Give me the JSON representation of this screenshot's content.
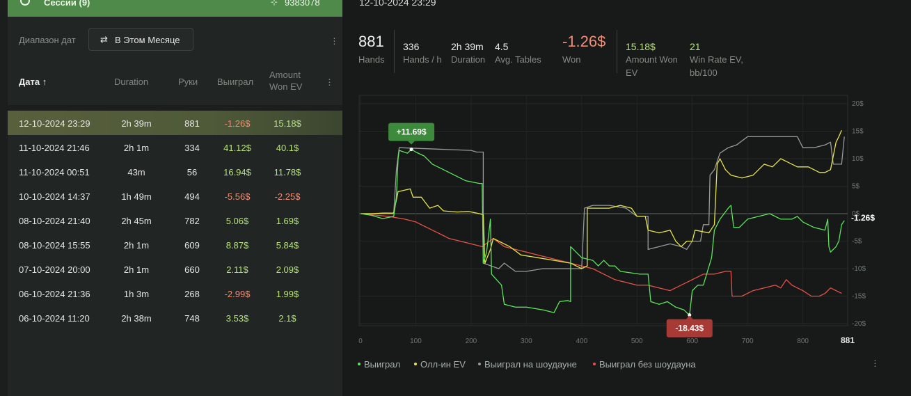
{
  "sessions_bar": {
    "title": "Сессии (9)",
    "total_hands": "9383078"
  },
  "filter": {
    "label": "Диапазон дат",
    "value": "В Этом Месяце"
  },
  "table": {
    "headers": {
      "date": "Дата ↑",
      "duration": "Duration",
      "hands": "Руки",
      "won": "Выиграл",
      "ev_line1": "Amount",
      "ev_line2": "Won EV"
    },
    "rows": [
      {
        "date": "12-10-2024 23:29",
        "duration": "2h 39m",
        "hands": "881",
        "won": "-1.26$",
        "ev": "15.18$"
      },
      {
        "date": "11-10-2024 21:46",
        "duration": "2h 1m",
        "hands": "334",
        "won": "41.12$",
        "ev": "40.1$"
      },
      {
        "date": "11-10-2024 00:51",
        "duration": "43m",
        "hands": "56",
        "won": "16.94$",
        "ev": "11.78$"
      },
      {
        "date": "10-10-2024 14:37",
        "duration": "1h 49m",
        "hands": "494",
        "won": "-5.56$",
        "ev": "-2.25$"
      },
      {
        "date": "08-10-2024 21:40",
        "duration": "2h 45m",
        "hands": "782",
        "won": "5.06$",
        "ev": "1.69$"
      },
      {
        "date": "08-10-2024 15:55",
        "duration": "2h 1m",
        "hands": "609",
        "won": "8.87$",
        "ev": "5.84$"
      },
      {
        "date": "07-10-2024 20:00",
        "duration": "2h 1m",
        "hands": "660",
        "won": "2.11$",
        "ev": "2.09$"
      },
      {
        "date": "06-10-2024 21:36",
        "duration": "1h 3m",
        "hands": "268",
        "won": "-2.99$",
        "ev": "1.99$"
      },
      {
        "date": "06-10-2024 11:20",
        "duration": "2h 38m",
        "hands": "748",
        "won": "3.53$",
        "ev": "2.1$"
      }
    ]
  },
  "session": {
    "date": "12-10-2024 23:29",
    "hands": {
      "value": "881",
      "label": "Hands"
    },
    "hands_per_hour": {
      "value": "336",
      "label": "Hands / h"
    },
    "duration": {
      "value": "2h 39m",
      "label": "Duration"
    },
    "avg_tables": {
      "value": "4.5",
      "label": "Avg. Tables"
    },
    "won": {
      "value": "-1.26$",
      "label": "Won"
    },
    "amount_won_ev": {
      "value": "15.18$",
      "label_line1": "Amount Won",
      "label_line2": "EV"
    },
    "win_rate_ev": {
      "value": "21",
      "label_line1": "Win Rate EV,",
      "label_line2": "bb/100"
    }
  },
  "colors": {
    "won": "#5ce65c",
    "allin_ev": "#e8e44a",
    "showdown": "#9a9a9a",
    "nonshowdown": "#e8524a",
    "accent": "#4f8a4a"
  },
  "chart_data": {
    "type": "line",
    "xlim": [
      0,
      881
    ],
    "ylim": [
      -20,
      20
    ],
    "x_ticks": [
      "0",
      "100",
      "200",
      "300",
      "400",
      "500",
      "600",
      "700",
      "800"
    ],
    "x_end_label": "881",
    "y_ticks": [
      "20$",
      "15$",
      "10$",
      "5$",
      "0$",
      "-5$",
      "-10$",
      "-15$",
      "-20$"
    ],
    "max_annotation": {
      "x": 92,
      "y": 11.69,
      "label": "+11.69$"
    },
    "min_annotation": {
      "x": 595,
      "y": -18.43,
      "label": "-18.43$"
    },
    "final_label": "-1.26$",
    "grid": true,
    "legend_position": "bottom-left",
    "series": [
      {
        "name": "Выиграл",
        "color": "#5ce65c",
        "points": [
          [
            0,
            0
          ],
          [
            20,
            -0.3
          ],
          [
            40,
            -0.9
          ],
          [
            60,
            -0.5
          ],
          [
            65,
            3
          ],
          [
            68,
            10
          ],
          [
            70,
            11.5
          ],
          [
            85,
            11
          ],
          [
            92,
            11.69
          ],
          [
            100,
            11.2
          ],
          [
            115,
            10.5
          ],
          [
            130,
            9
          ],
          [
            150,
            8
          ],
          [
            170,
            7
          ],
          [
            190,
            6
          ],
          [
            215,
            5.5
          ],
          [
            220,
            5.5
          ],
          [
            222,
            -9
          ],
          [
            228,
            -7
          ],
          [
            235,
            -1
          ],
          [
            237,
            -11
          ],
          [
            255,
            -13
          ],
          [
            260,
            -16.5
          ],
          [
            280,
            -17
          ],
          [
            300,
            -17
          ],
          [
            330,
            -17.5
          ],
          [
            350,
            -18
          ],
          [
            360,
            -16
          ],
          [
            375,
            -15.8
          ],
          [
            380,
            -16
          ],
          [
            380,
            -6
          ],
          [
            400,
            -8
          ],
          [
            420,
            -8.5
          ],
          [
            430,
            -9.5
          ],
          [
            440,
            -8.5
          ],
          [
            450,
            -9.5
          ],
          [
            460,
            -9.5
          ],
          [
            470,
            -10.5
          ],
          [
            505,
            -11
          ],
          [
            520,
            -11
          ],
          [
            525,
            -16
          ],
          [
            540,
            -16.5
          ],
          [
            555,
            -16
          ],
          [
            570,
            -17
          ],
          [
            585,
            -17.5
          ],
          [
            590,
            -18
          ],
          [
            595,
            -18.43
          ],
          [
            600,
            -14
          ],
          [
            610,
            -13
          ],
          [
            620,
            -13
          ],
          [
            635,
            -8
          ],
          [
            640,
            -3
          ],
          [
            645,
            -2
          ],
          [
            650,
            -1
          ],
          [
            665,
            1
          ],
          [
            670,
            1.5
          ],
          [
            675,
            -2.5
          ],
          [
            685,
            -2.5
          ],
          [
            700,
            -1
          ],
          [
            720,
            -0.5
          ],
          [
            740,
            0
          ],
          [
            760,
            -1
          ],
          [
            780,
            -1
          ],
          [
            790,
            -0.5
          ],
          [
            800,
            -1.5
          ],
          [
            820,
            -2.5
          ],
          [
            840,
            -3
          ],
          [
            845,
            -1
          ],
          [
            847,
            -6
          ],
          [
            850,
            -7
          ],
          [
            860,
            -6
          ],
          [
            865,
            -5
          ],
          [
            870,
            -2
          ],
          [
            875,
            -1.26
          ]
        ]
      },
      {
        "name": "Олл-ин EV",
        "color": "#e8e44a",
        "points": [
          [
            0,
            0
          ],
          [
            20,
            0
          ],
          [
            40,
            0.1
          ],
          [
            60,
            0.1
          ],
          [
            65,
            2.5
          ],
          [
            68,
            4
          ],
          [
            90,
            4.5
          ],
          [
            95,
            3
          ],
          [
            110,
            3
          ],
          [
            125,
            1
          ],
          [
            140,
            1.5
          ],
          [
            150,
            0.5
          ],
          [
            175,
            0.3
          ],
          [
            195,
            0.4
          ],
          [
            215,
            0
          ],
          [
            222,
            -0.2
          ],
          [
            225,
            -9
          ],
          [
            235,
            -6.5
          ],
          [
            240,
            -4.5
          ],
          [
            250,
            -5
          ],
          [
            270,
            -6
          ],
          [
            290,
            -7.5
          ],
          [
            320,
            -8
          ],
          [
            350,
            -8.5
          ],
          [
            380,
            -9
          ],
          [
            390,
            -9.5
          ],
          [
            400,
            -10
          ],
          [
            410,
            -9.5
          ],
          [
            410,
            1
          ],
          [
            430,
            1
          ],
          [
            450,
            1
          ],
          [
            470,
            1.5
          ],
          [
            490,
            1
          ],
          [
            500,
            -0.5
          ],
          [
            515,
            -0.5
          ],
          [
            520,
            -3
          ],
          [
            540,
            -3.5
          ],
          [
            560,
            -3
          ],
          [
            570,
            -5
          ],
          [
            580,
            -6
          ],
          [
            590,
            -5
          ],
          [
            600,
            -5
          ],
          [
            605,
            -3
          ],
          [
            630,
            -3.5
          ],
          [
            640,
            -2
          ],
          [
            645,
            9
          ],
          [
            650,
            10
          ],
          [
            660,
            8
          ],
          [
            670,
            7
          ],
          [
            690,
            6.5
          ],
          [
            710,
            7
          ],
          [
            730,
            9
          ],
          [
            745,
            8.5
          ],
          [
            760,
            10
          ],
          [
            770,
            9.5
          ],
          [
            790,
            8.5
          ],
          [
            810,
            8.5
          ],
          [
            830,
            7.5
          ],
          [
            840,
            7.5
          ],
          [
            850,
            8
          ],
          [
            860,
            13
          ],
          [
            865,
            14
          ],
          [
            870,
            15.18
          ]
        ]
      },
      {
        "name": "Выиграл на шоудауне",
        "color": "#9a9a9a",
        "points": [
          [
            0,
            0
          ],
          [
            60,
            0
          ],
          [
            65,
            8
          ],
          [
            70,
            12
          ],
          [
            200,
            11.5
          ],
          [
            210,
            11.2
          ],
          [
            222,
            11.2
          ],
          [
            222,
            -9
          ],
          [
            250,
            -10
          ],
          [
            260,
            -9
          ],
          [
            280,
            -10.5
          ],
          [
            300,
            -10.5
          ],
          [
            330,
            -10
          ],
          [
            350,
            -10
          ],
          [
            380,
            -10
          ],
          [
            400,
            -10
          ],
          [
            405,
            1
          ],
          [
            420,
            1.5
          ],
          [
            450,
            1.5
          ],
          [
            480,
            1
          ],
          [
            500,
            -0.5
          ],
          [
            520,
            -0.5
          ],
          [
            520,
            -6.5
          ],
          [
            540,
            -6
          ],
          [
            560,
            -5.5
          ],
          [
            580,
            -6
          ],
          [
            590,
            -6.5
          ],
          [
            600,
            -5
          ],
          [
            615,
            -5
          ],
          [
            620,
            -2
          ],
          [
            630,
            -2
          ],
          [
            632,
            7
          ],
          [
            640,
            8
          ],
          [
            650,
            11
          ],
          [
            665,
            12
          ],
          [
            680,
            12.5
          ],
          [
            700,
            14
          ],
          [
            740,
            14
          ],
          [
            790,
            14
          ],
          [
            800,
            12
          ],
          [
            820,
            12
          ],
          [
            840,
            12.5
          ],
          [
            850,
            13
          ],
          [
            855,
            9
          ],
          [
            870,
            9
          ],
          [
            875,
            14
          ]
        ]
      },
      {
        "name": "Выиграл без шоудауна",
        "color": "#e8524a",
        "points": [
          [
            0,
            0
          ],
          [
            50,
            -0.5
          ],
          [
            80,
            -1
          ],
          [
            100,
            -1.5
          ],
          [
            120,
            -2.5
          ],
          [
            140,
            -3.5
          ],
          [
            160,
            -4.5
          ],
          [
            180,
            -5
          ],
          [
            200,
            -5.5
          ],
          [
            220,
            -6
          ],
          [
            240,
            -4.5
          ],
          [
            260,
            -6
          ],
          [
            280,
            -6.5
          ],
          [
            300,
            -7
          ],
          [
            320,
            -7.5
          ],
          [
            340,
            -8
          ],
          [
            360,
            -8.5
          ],
          [
            380,
            -9
          ],
          [
            400,
            -9.5
          ],
          [
            420,
            -10
          ],
          [
            440,
            -11
          ],
          [
            460,
            -12
          ],
          [
            480,
            -12.5
          ],
          [
            500,
            -13
          ],
          [
            520,
            -13
          ],
          [
            540,
            -13.5
          ],
          [
            560,
            -14
          ],
          [
            580,
            -13
          ],
          [
            600,
            -12
          ],
          [
            610,
            -11.5
          ],
          [
            620,
            -11
          ],
          [
            640,
            -11
          ],
          [
            660,
            -10.5
          ],
          [
            670,
            -10.5
          ],
          [
            672,
            -15
          ],
          [
            690,
            -15
          ],
          [
            710,
            -14
          ],
          [
            730,
            -13.5
          ],
          [
            750,
            -13
          ],
          [
            760,
            -13.5
          ],
          [
            770,
            -12
          ],
          [
            780,
            -13
          ],
          [
            800,
            -14
          ],
          [
            815,
            -15
          ],
          [
            830,
            -15
          ],
          [
            840,
            -14.5
          ],
          [
            850,
            -13.5
          ],
          [
            860,
            -14
          ],
          [
            870,
            -14.5
          ]
        ]
      }
    ]
  }
}
